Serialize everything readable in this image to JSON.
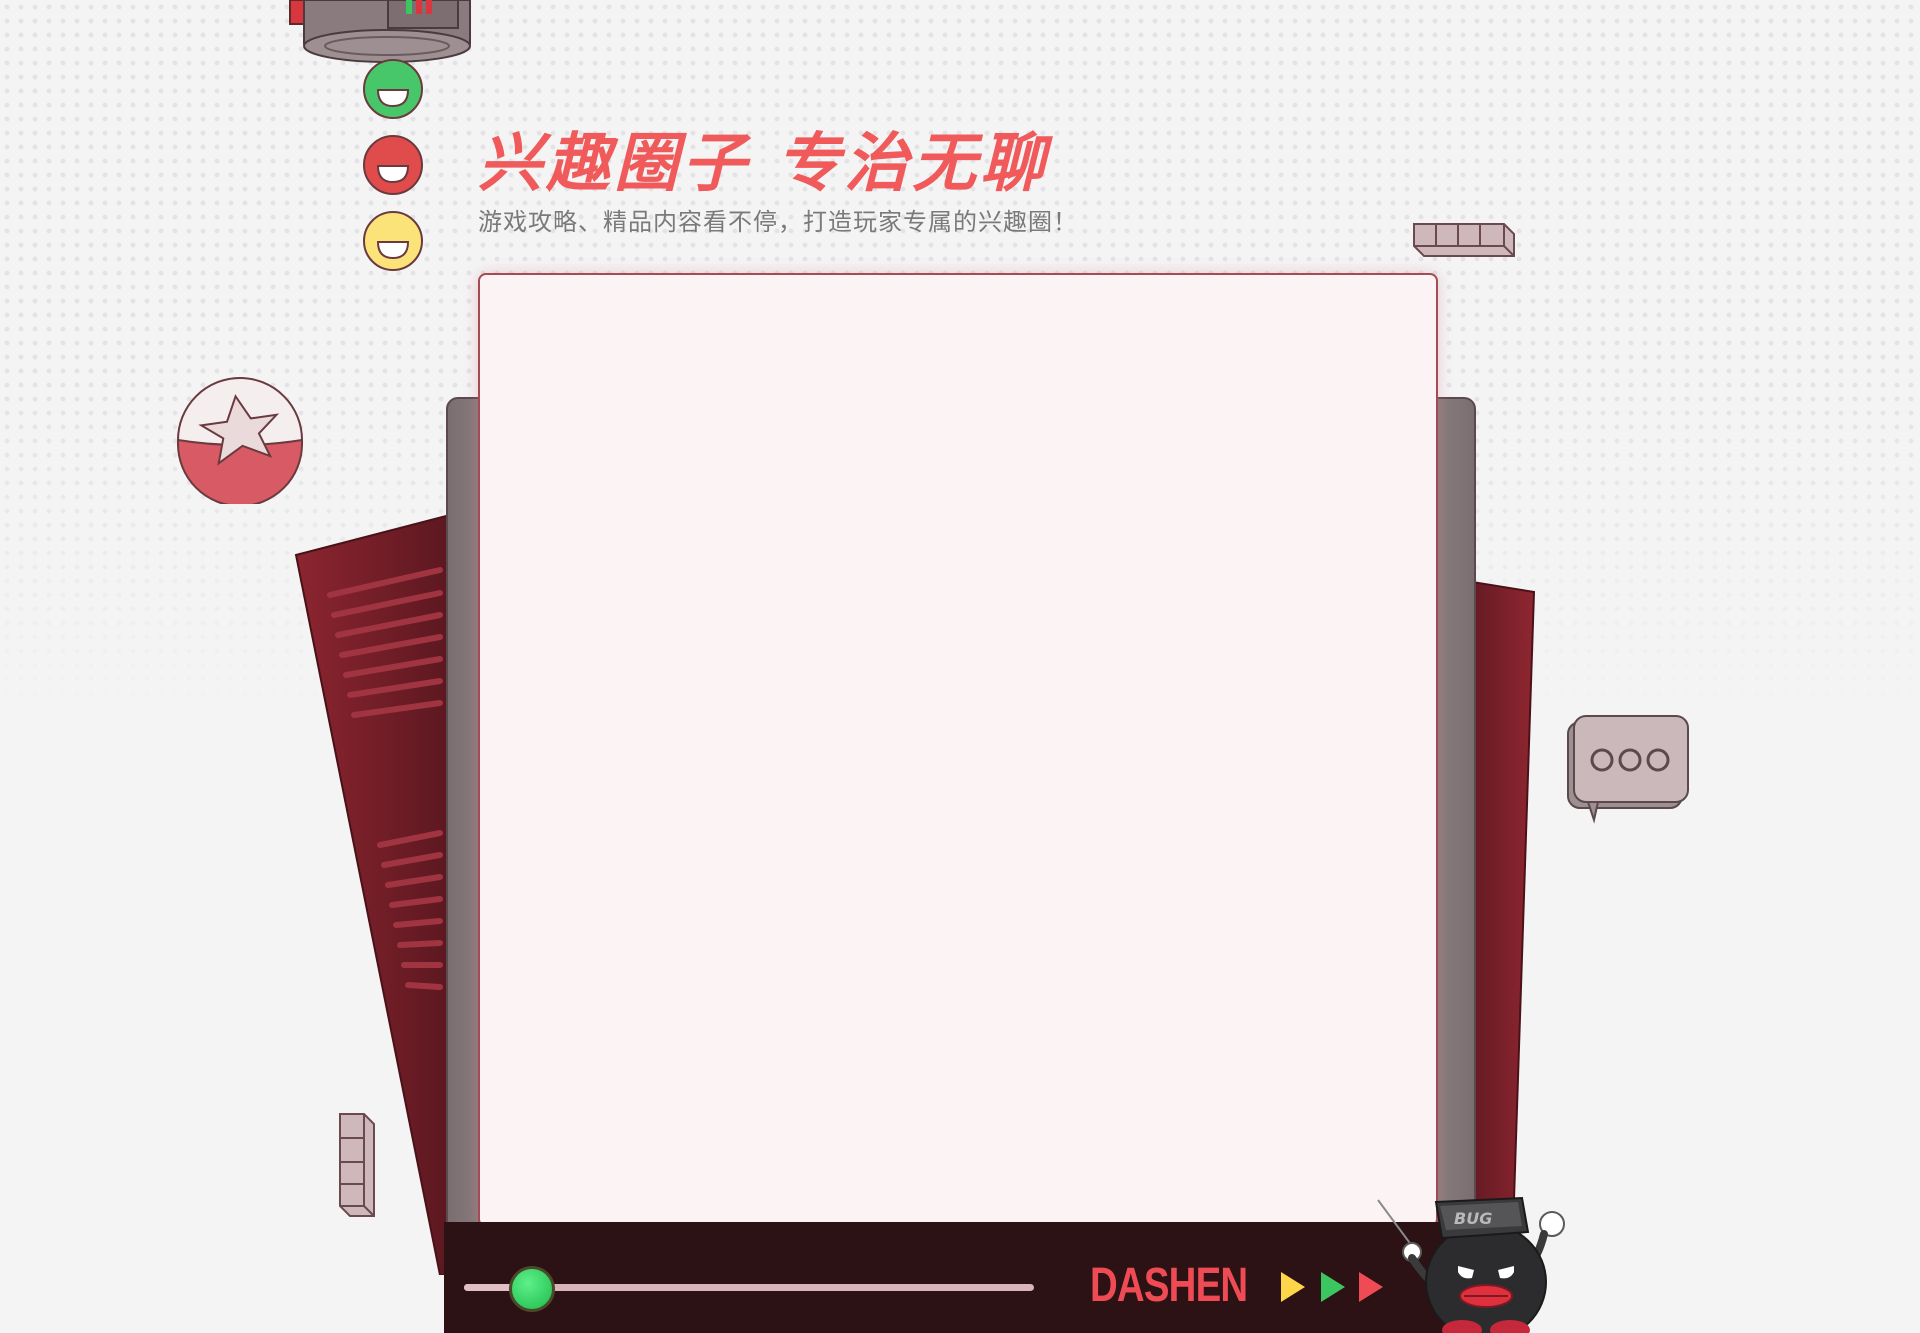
{
  "header": {
    "title": "兴趣圈子 专治无聊",
    "subtitle": "游戏攻略、精品内容看不停，打造玩家专属的兴趣圈！"
  },
  "footer_bar": {
    "brand": "DASHEN",
    "progress_percent": 12,
    "arrow_colors": [
      "#ffd54a",
      "#3cc660",
      "#ef4b54"
    ]
  },
  "mascot": {
    "hat_label": "BUG"
  },
  "chat_bubble": {
    "icon": "ellipsis-icon"
  },
  "colors": {
    "accent": "#f05a5a",
    "card_bg": "#fcf3f4",
    "bar_bg": "#2c1214",
    "dot_green": "#47c76a",
    "dot_red": "#e04b4b",
    "dot_yellow": "#fbe37a"
  }
}
